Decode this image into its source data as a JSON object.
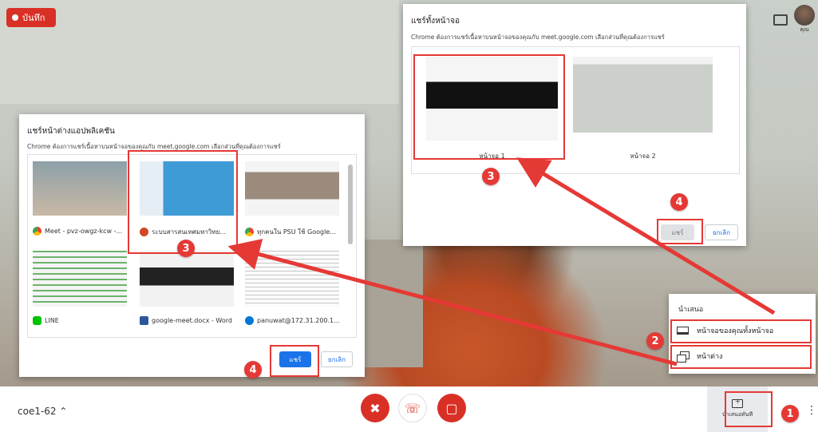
{
  "record": {
    "label": "บันทึก"
  },
  "top_bar": {
    "self_label": "คุณ"
  },
  "app_dialog": {
    "title": "แชร์หน้าต่างแอปพลิเคชัน",
    "subtitle": "Chrome ต้องการแชร์เนื้อหาบนหน้าจอของคุณกับ meet.google.com เลือกส่วนที่คุณต้องการแชร์",
    "windows": [
      {
        "label": "Meet - pvz-owgz-kcw -...",
        "icon": "chrome-icon"
      },
      {
        "label": "ระบบสารสนเทศมหาวิทย...",
        "icon": "powerpoint-icon"
      },
      {
        "label": "ทุกคนใน PSU ใช้ Google...",
        "icon": "chrome-icon"
      },
      {
        "label": "LINE",
        "icon": "line-icon"
      },
      {
        "label": "google-meet.docx - Word",
        "icon": "word-icon"
      },
      {
        "label": "panuwat@172.31.200.1...",
        "icon": "remote-desktop-icon"
      }
    ],
    "share_label": "แชร์",
    "cancel_label": "ยกเลิก"
  },
  "screen_dialog": {
    "title": "แชร์ทั้งหน้าจอ",
    "subtitle": "Chrome ต้องการแชร์เนื้อหาบนหน้าจอของคุณกับ meet.google.com เลือกส่วนที่คุณต้องการแชร์",
    "screens": [
      {
        "label": "หน้าจอ 1"
      },
      {
        "label": "หน้าจอ 2"
      }
    ],
    "share_label": "แชร์",
    "cancel_label": "ยกเลิก"
  },
  "present_menu": {
    "title": "นำเสนอ",
    "items": [
      {
        "label": "หน้าจอของคุณทั้งหน้าจอ",
        "icon": "monitor-icon"
      },
      {
        "label": "หน้าต่าง",
        "icon": "window-icon"
      }
    ]
  },
  "bottom_bar": {
    "meeting_code": "coe1-62",
    "present_now_label": "นำเสนอทันที"
  },
  "annotations": {
    "step1": "1",
    "step2": "2",
    "step3a": "3",
    "step3b": "3",
    "step4a": "4",
    "step4b": "4",
    "color": "#e53935"
  },
  "colors": {
    "accent": "#1a73e8",
    "record": "#d93025",
    "end_call": "#ffffff",
    "mute": "#d93025"
  }
}
